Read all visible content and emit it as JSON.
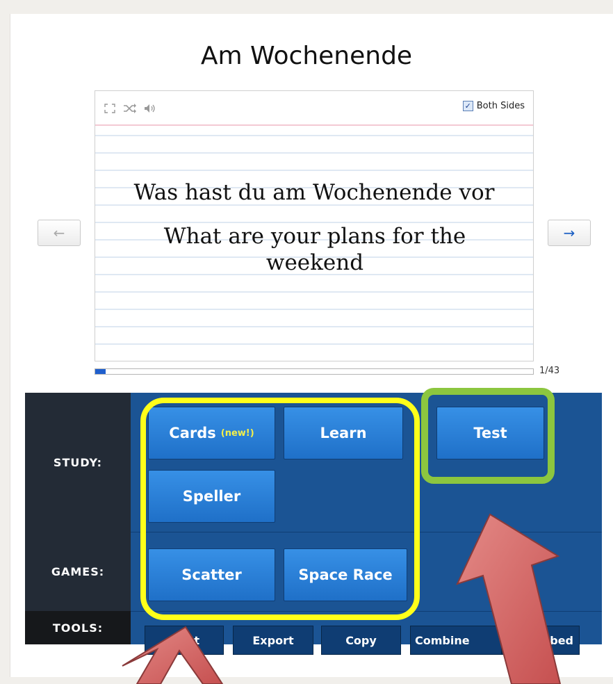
{
  "set": {
    "title": "Am Wochenende"
  },
  "card": {
    "term": "Was hast du am Wochenende vor",
    "definition": "What are your plans for the weekend",
    "both_sides_label": "Both Sides",
    "both_sides_checked": true
  },
  "controls": {
    "fullscreen_icon": "fullscreen-icon",
    "shuffle_icon": "shuffle-icon",
    "audio_icon": "speaker-icon"
  },
  "navigation": {
    "prev": "←",
    "next": "→"
  },
  "progress": {
    "label": "1/43",
    "current": 1,
    "total": 43
  },
  "study": {
    "label": "STUDY:",
    "cards_label": "Cards",
    "cards_badge": "(new!)",
    "learn_label": "Learn",
    "test_label": "Test",
    "speller_label": "Speller"
  },
  "games": {
    "label": "GAMES:",
    "scatter_label": "Scatter",
    "space_race_label": "Space Race"
  },
  "tools": {
    "label": "TOOLS:",
    "items": [
      "Print",
      "Export",
      "Copy",
      "Combine",
      "Embed"
    ]
  },
  "colors": {
    "activities_bg": "#1b5494",
    "button_blue": "#2a7fd8",
    "highlight_yellow": "#ffff1a",
    "highlight_green": "#8cc63f",
    "arrow_red": "#d86565"
  }
}
